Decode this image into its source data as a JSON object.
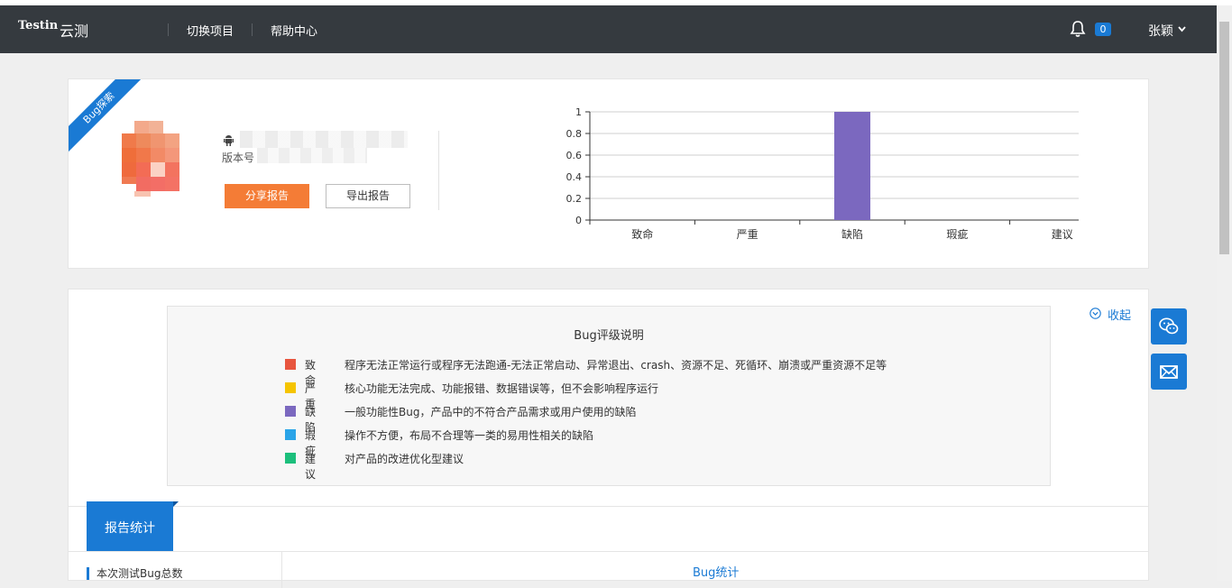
{
  "nav": {
    "logo_text": "Testin",
    "brand": "云测",
    "links": [
      "切换项目",
      "帮助中心"
    ],
    "notification_count": "0",
    "user_name": "张颖"
  },
  "report": {
    "ribbon": "Bug探索",
    "version_label": "版本号",
    "share_button": "分享报告",
    "export_button": "导出报告"
  },
  "chart_data": {
    "type": "bar",
    "categories": [
      "致命",
      "严重",
      "缺陷",
      "瑕疵",
      "建议"
    ],
    "values": [
      0,
      0,
      1,
      0,
      0
    ],
    "ylim": [
      0,
      1
    ],
    "yticks": [
      "1",
      "0.8",
      "0.6",
      "0.4",
      "0.2",
      "0"
    ],
    "grid": true,
    "bar_color": "#7b68bf"
  },
  "legend": {
    "title": "Bug评级说明",
    "collapse": "收起",
    "rows": [
      {
        "name": "致命",
        "desc": "程序无法正常运行或程序无法跑通-无法正常启动、异常退出、crash、资源不足、死循环、崩溃或严重资源不足等",
        "color": "#e8553e"
      },
      {
        "name": "严重",
        "desc": "核心功能无法完成、功能报错、数据错误等，但不会影响程序运行",
        "color": "#f5c400"
      },
      {
        "name": "缺陷",
        "desc": "一般功能性Bug，产品中的不符合产品需求或用户使用的缺陷",
        "color": "#7b68bf"
      },
      {
        "name": "瑕疵",
        "desc": "操作不方便，布局不合理等一类的易用性相关的缺陷",
        "color": "#2aa4e8"
      },
      {
        "name": "建议",
        "desc": "对产品的改进优化型建议",
        "color": "#1cbf7c"
      }
    ]
  },
  "stats": {
    "tab": "报告统计",
    "total_label": "本次测试Bug总数",
    "bug_stat_title": "Bug统计"
  }
}
